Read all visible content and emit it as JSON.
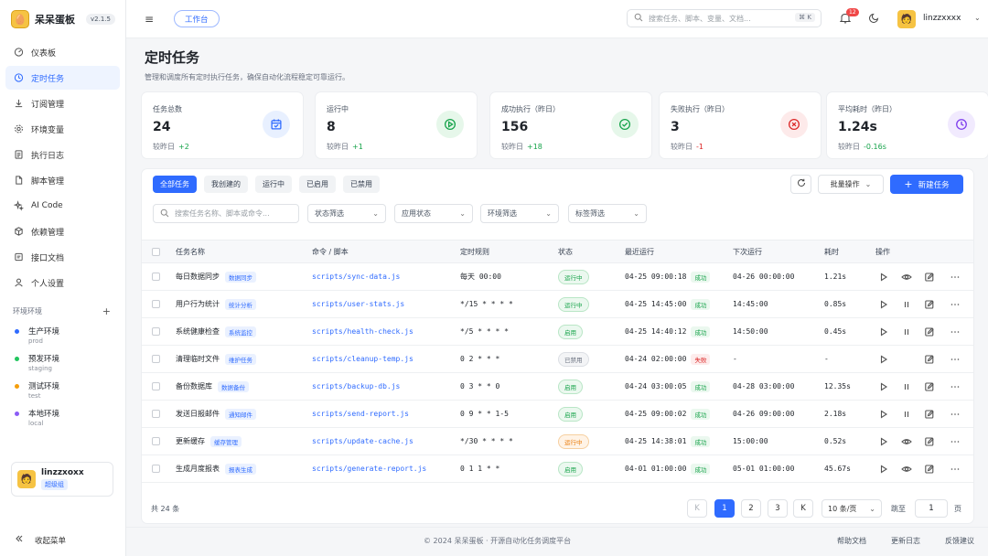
{
  "app": {
    "name": "呆呆蛋板",
    "version": "v2.1.5"
  },
  "sidebar": {
    "items": [
      {
        "label": "仪表板",
        "icon": "dashboard-icon"
      },
      {
        "label": "定时任务",
        "icon": "clock-icon",
        "active": true
      },
      {
        "label": "订阅管理",
        "icon": "download-icon"
      },
      {
        "label": "环境变量",
        "icon": "gear-icon"
      },
      {
        "label": "执行日志",
        "icon": "log-icon"
      },
      {
        "label": "脚本管理",
        "icon": "file-icon"
      },
      {
        "label": "AI Code",
        "icon": "sparkle-icon"
      },
      {
        "label": "依赖管理",
        "icon": "package-icon"
      },
      {
        "label": "接口文档",
        "icon": "api-icon"
      },
      {
        "label": "个人设置",
        "icon": "user-icon"
      }
    ],
    "env_title": "环境环境",
    "envs": [
      {
        "name": "生产环境",
        "sub": "prod",
        "color": "#2f6bff"
      },
      {
        "name": "预发环境",
        "sub": "staging",
        "color": "#22c55e"
      },
      {
        "name": "测试环境",
        "sub": "test",
        "color": "#f59e0b"
      },
      {
        "name": "本地环境",
        "sub": "local",
        "color": "#8b5cf6"
      }
    ],
    "user": {
      "name": "linzzxoxx",
      "role": "超级组"
    },
    "collapse_label": "收起菜单"
  },
  "topbar": {
    "workbench": "工作台",
    "search_placeholder": "搜索任务、脚本、变量、文档...",
    "shortcut": "⌘ K",
    "notifications": "12",
    "username": "linzzxxxx"
  },
  "page": {
    "title": "定时任务",
    "subtitle": "管理和调度所有定时执行任务，确保自动化流程稳定可靠运行。"
  },
  "stats": [
    {
      "label": "任务总数",
      "value": "24",
      "comp_label": "较昨日",
      "delta": "+2",
      "delta_color": "#16a34a",
      "icon": "calendar-icon",
      "icon_color": "#2f6bff",
      "icon_bg": "#e8f0ff"
    },
    {
      "label": "运行中",
      "value": "8",
      "comp_label": "较昨日",
      "delta": "+1",
      "delta_color": "#16a34a",
      "icon": "play-circle-icon",
      "icon_color": "#16a34a",
      "icon_bg": "#e6f7ea"
    },
    {
      "label": "成功执行（昨日）",
      "value": "156",
      "comp_label": "较昨日",
      "delta": "+18",
      "delta_color": "#16a34a",
      "icon": "check-circle-icon",
      "icon_color": "#16a34a",
      "icon_bg": "#e6f7ea"
    },
    {
      "label": "失败执行（昨日）",
      "value": "3",
      "comp_label": "较昨日",
      "delta": "-1",
      "delta_color": "#dc2626",
      "icon": "x-circle-icon",
      "icon_color": "#dc2626",
      "icon_bg": "#fdeaea"
    },
    {
      "label": "平均耗时（昨日）",
      "value": "1.24s",
      "comp_label": "较昨日",
      "delta": "-0.16s",
      "delta_color": "#16a34a",
      "icon": "clock-icon",
      "icon_color": "#7c3aed",
      "icon_bg": "#f1eafe"
    }
  ],
  "tabs": [
    "全部任务",
    "我创建的",
    "运行中",
    "已启用",
    "已禁用"
  ],
  "toolbar": {
    "batch": "批量操作",
    "new_task": "新建任务"
  },
  "filters": {
    "search_placeholder": "搜索任务名称、脚本或命令...",
    "selects": [
      "状态筛选",
      "应用状态",
      "环境筛选",
      "标签筛选"
    ]
  },
  "table": {
    "headers": [
      "任务名称",
      "命令 / 脚本",
      "定时规则",
      "状态",
      "最近运行",
      "下次运行",
      "耗时",
      "操作"
    ],
    "rows": [
      {
        "name": "每日数据同步",
        "tag": "数据同步",
        "cmd": "scripts/sync-data.js",
        "cron": "每天 00:00",
        "status": "运行中",
        "status_type": "green",
        "last": "04-25 09:00:18",
        "result": "成功",
        "result_type": "ok",
        "next": "04-26 00:00:00",
        "duration": "1.21s",
        "second_action": "eye-icon"
      },
      {
        "name": "用户行为统计",
        "tag": "统计分析",
        "cmd": "scripts/user-stats.js",
        "cron": "*/15 * * * *",
        "status": "运行中",
        "status_type": "green",
        "last": "04-25 14:45:00",
        "result": "成功",
        "result_type": "ok",
        "next": "14:45:00",
        "duration": "0.85s",
        "second_action": "pause-icon"
      },
      {
        "name": "系统健康检查",
        "tag": "系统监控",
        "cmd": "scripts/health-check.js",
        "cron": "*/5 * * * *",
        "status": "启用",
        "status_type": "green",
        "last": "04-25 14:40:12",
        "result": "成功",
        "result_type": "ok",
        "next": "14:50:00",
        "duration": "0.45s",
        "second_action": "pause-icon"
      },
      {
        "name": "清理临时文件",
        "tag": "维护任务",
        "cmd": "scripts/cleanup-temp.js",
        "cron": "0 2 * * *",
        "status": "已禁用",
        "status_type": "gray",
        "last": "04-24 02:00:00",
        "result": "失败",
        "result_type": "fail",
        "next": "-",
        "duration": "-",
        "second_action": "none"
      },
      {
        "name": "备份数据库",
        "tag": "数据备份",
        "cmd": "scripts/backup-db.js",
        "cron": "0 3 * * 0",
        "status": "启用",
        "status_type": "green",
        "last": "04-24 03:00:05",
        "result": "成功",
        "result_type": "ok",
        "next": "04-28 03:00:00",
        "duration": "12.35s",
        "second_action": "pause-icon"
      },
      {
        "name": "发送日报邮件",
        "tag": "通知邮件",
        "cmd": "scripts/send-report.js",
        "cron": "0 9 * * 1-5",
        "status": "启用",
        "status_type": "green",
        "last": "04-25 09:00:02",
        "result": "成功",
        "result_type": "ok",
        "next": "04-26 09:00:00",
        "duration": "2.18s",
        "second_action": "pause-icon"
      },
      {
        "name": "更新缓存",
        "tag": "缓存管理",
        "cmd": "scripts/update-cache.js",
        "cron": "*/30 * * * *",
        "status": "运行中",
        "status_type": "orange",
        "last": "04-25 14:38:01",
        "result": "成功",
        "result_type": "ok",
        "next": "15:00:00",
        "duration": "0.52s",
        "second_action": "eye-icon"
      },
      {
        "name": "生成月度报表",
        "tag": "报表生成",
        "cmd": "scripts/generate-report.js",
        "cron": "0 1 1 * *",
        "status": "启用",
        "status_type": "green",
        "last": "04-01 01:00:00",
        "result": "成功",
        "result_type": "ok",
        "next": "05-01 01:00:00",
        "duration": "45.67s",
        "second_action": "eye-icon"
      }
    ]
  },
  "pagination": {
    "total": "共 24 条",
    "first": "K",
    "pages": [
      "1",
      "2",
      "3"
    ],
    "last": "K",
    "per_page": "10 条/页",
    "jump_label": "跳至",
    "jump_value": "1",
    "page_unit": "页"
  },
  "footer": {
    "copyright": "© 2024 呆呆蛋板 · 开源自动化任务调度平台",
    "links": [
      "帮助文档",
      "更新日志",
      "反馈建议"
    ]
  }
}
